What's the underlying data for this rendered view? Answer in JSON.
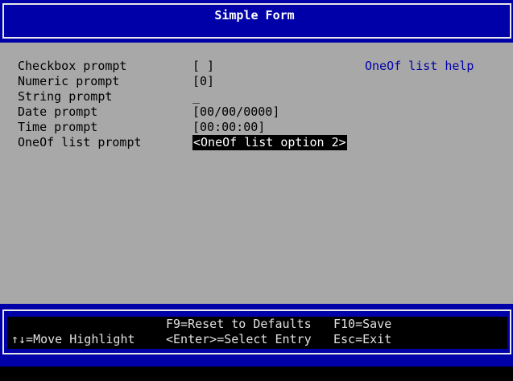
{
  "header": {
    "title": "Simple Form"
  },
  "form": {
    "rows": [
      {
        "prompt": "Checkbox prompt",
        "value": "[ ]"
      },
      {
        "prompt": "Numeric prompt",
        "value": "[0]"
      },
      {
        "prompt": "String prompt",
        "value": "_"
      },
      {
        "prompt": "Date prompt",
        "value": "[00/00/0000]"
      },
      {
        "prompt": "Time prompt",
        "value": "[00:00:00]"
      },
      {
        "prompt": "OneOf list prompt",
        "value": "<OneOf list option 2>"
      }
    ],
    "help_text": "OneOf list help"
  },
  "footer": {
    "move_highlight": "↑↓=Move Highlight",
    "reset_defaults": "F9=Reset to Defaults",
    "select_entry": "<Enter>=Select Entry",
    "save": "F10=Save",
    "exit": "Esc=Exit"
  },
  "colors": {
    "header_bg": "#0000a8",
    "body_bg": "#a8a8a8",
    "help_text": "#0000a8",
    "selected_bg": "#000000"
  }
}
